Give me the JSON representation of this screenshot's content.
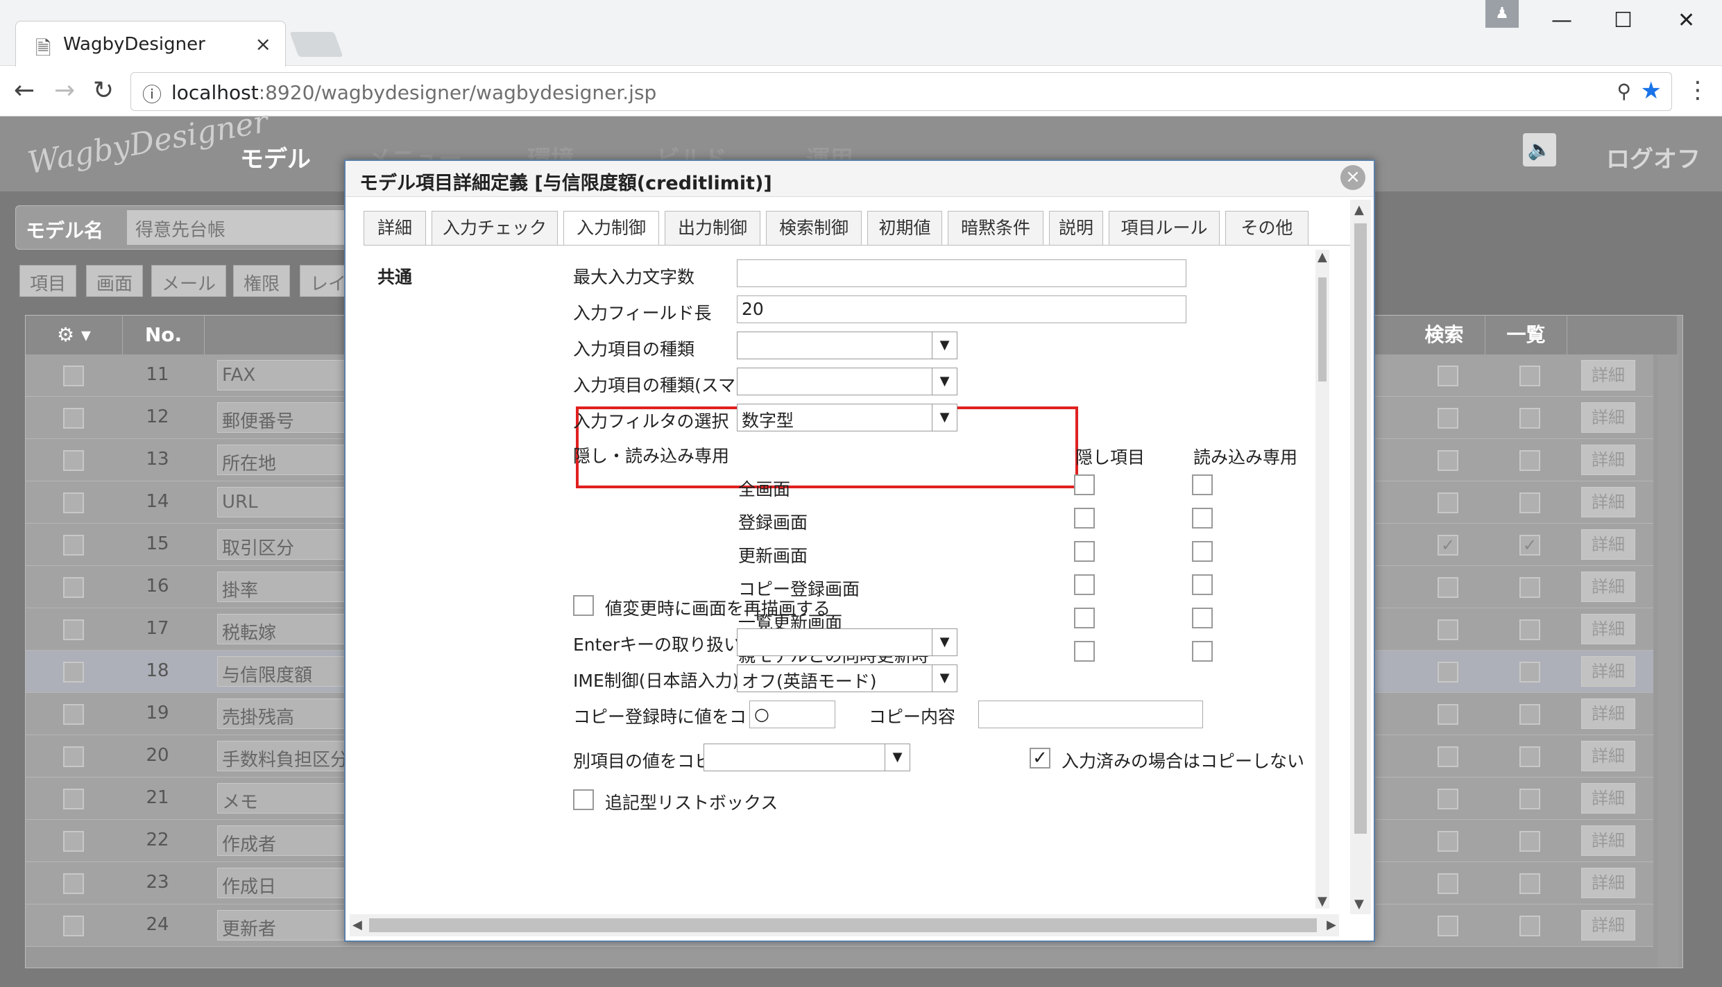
{
  "browser": {
    "tab_title": "WagbyDesigner",
    "tab_close": "×",
    "url_host": "localhost",
    "url_path": ":8920/wagbydesigner/wagbydesigner.jsp"
  },
  "app": {
    "logo": "WagbyDesigner",
    "nav": [
      "モデル",
      "メニュー",
      "環境",
      "ビルド",
      "運用"
    ],
    "logoff": "ログオフ",
    "model_name_label": "モデル名",
    "model_name_value": "得意先台帳",
    "subtabs": [
      "項目",
      "画面",
      "メール",
      "権限",
      "レイ"
    ],
    "grid": {
      "headers": {
        "no": "No.",
        "search": "検索",
        "list": "一覧"
      },
      "detail_label": "詳細",
      "rows": [
        {
          "no": "11",
          "name": "FAX",
          "search": false,
          "list": false
        },
        {
          "no": "12",
          "name": "郵便番号",
          "search": false,
          "list": false
        },
        {
          "no": "13",
          "name": "所在地",
          "search": false,
          "list": false
        },
        {
          "no": "14",
          "name": "URL",
          "search": false,
          "list": false
        },
        {
          "no": "15",
          "name": "取引区分",
          "search": true,
          "list": true
        },
        {
          "no": "16",
          "name": "掛率",
          "search": false,
          "list": false
        },
        {
          "no": "17",
          "name": "税転嫁",
          "search": false,
          "list": false
        },
        {
          "no": "18",
          "name": "与信限度額",
          "search": false,
          "list": false,
          "selected": true
        },
        {
          "no": "19",
          "name": "売掛残高",
          "search": false,
          "list": false
        },
        {
          "no": "20",
          "name": "手数料負担区分",
          "search": false,
          "list": false
        },
        {
          "no": "21",
          "name": "メモ",
          "search": false,
          "list": false
        },
        {
          "no": "22",
          "name": "作成者",
          "search": false,
          "list": false
        },
        {
          "no": "23",
          "name": "作成日",
          "search": false,
          "list": false
        },
        {
          "no": "24",
          "name": "更新者",
          "search": false,
          "list": false
        }
      ]
    }
  },
  "dialog": {
    "title": "モデル項目詳細定義 [与信限度額(creditlimit)]",
    "close": "×",
    "tabs": [
      "詳細",
      "入力チェック",
      "入力制御",
      "出力制御",
      "検索制御",
      "初期値",
      "暗黙条件",
      "説明",
      "項目ルール",
      "その他"
    ],
    "active_tab": "入力制御",
    "section": "共通",
    "fields": {
      "max_input_chars": {
        "label": "最大入力文字数",
        "value": ""
      },
      "input_field_length": {
        "label": "入力フィールド長",
        "value": "20"
      },
      "input_type": {
        "label": "入力項目の種類",
        "value": ""
      },
      "input_type_sp": {
        "label": "入力項目の種類(スマートフォン)",
        "value": ""
      },
      "input_filter": {
        "label": "入力フィルタの選択",
        "value": "数字型"
      },
      "hidden_readonly": {
        "label": "隠し・読み込み専用",
        "col_hidden": "隠し項目",
        "col_readonly": "読み込み専用",
        "rows": [
          "全画面",
          "登録画面",
          "更新画面",
          "コピー登録画面",
          "一覧更新画面",
          "親モデルとの同時更新時"
        ]
      },
      "redraw_on_change": {
        "label": "値変更時に画面を再描画する",
        "checked": false
      },
      "enter_key": {
        "label": "Enterキーの取り扱い",
        "value": ""
      },
      "ime": {
        "label": "IME制御(日本語入力)",
        "value": "オフ(英語モード)"
      },
      "copy_on_copyreg": {
        "label": "コピー登録時に値をコピーする",
        "value": "○",
        "content_label": "コピー内容",
        "content_value": ""
      },
      "copy_from_other": {
        "label": "別項目の値をコピーする",
        "value": "",
        "skip_label": "入力済みの場合はコピーしない",
        "skip_checked": true
      },
      "append_listbox": {
        "label": "追記型リストボックス",
        "checked": false
      }
    }
  },
  "colors": {
    "highlight": "#e02020",
    "accent": "#1a73e8"
  }
}
